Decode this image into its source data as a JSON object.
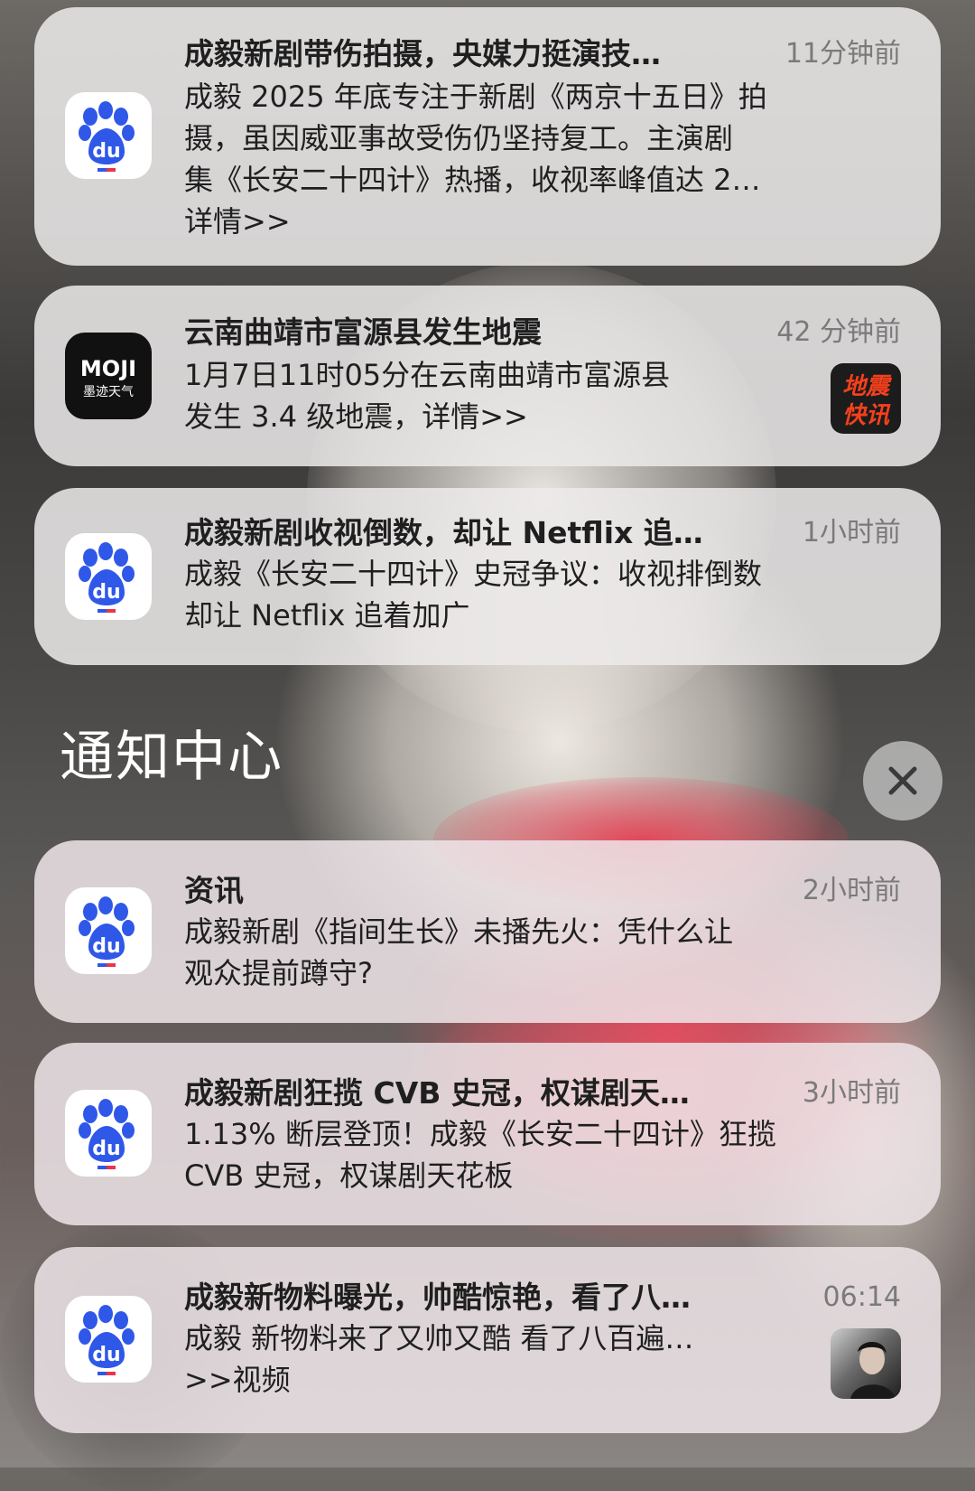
{
  "notifications_top": [
    {
      "app": "baidu",
      "title": "成毅新剧带伤拍摄，央媒力挺演技…",
      "time": "11分钟前",
      "body": [
        "成毅 2025 年底专注于新剧《两京十五日》拍",
        "摄，虽因威亚事故受伤仍坚持复工。主演剧",
        "集《长安二十四计》热播，收视率峰值达 2…",
        "详情>>"
      ]
    },
    {
      "app": "moji",
      "app_label_top": "MOJI",
      "app_label_bottom": "墨迹天气",
      "title": "云南曲靖市富源县发生地震",
      "time": "42 分钟前",
      "body": [
        "1月7日11时05分在云南曲靖市富源县",
        "发生 3.4 级地震，详情>>"
      ],
      "badge_line1": "地震",
      "badge_line2": "快讯"
    },
    {
      "app": "baidu",
      "title": "成毅新剧收视倒数，却让 Netflix 追…",
      "time": "1小时前",
      "body": [
        "成毅《长安二十四计》史冠争议：收视排倒数",
        "却让 Netflix 追着加广"
      ]
    }
  ],
  "notification_center": {
    "title": "通知中心",
    "close_icon": "close-icon"
  },
  "notifications_bottom": [
    {
      "app": "baidu",
      "title": "资讯",
      "time": "2小时前",
      "body": [
        "成毅新剧《指间生长》未播先火：凭什么让",
        "观众提前蹲守?"
      ]
    },
    {
      "app": "baidu",
      "title": "成毅新剧狂揽 CVB 史冠，权谋剧天…",
      "time": "3小时前",
      "body": [
        "1.13% 断层登顶！成毅《长安二十四计》狂揽",
        "CVB 史冠，权谋剧天花板"
      ]
    },
    {
      "app": "baidu",
      "title": "成毅新物料曝光，帅酷惊艳，看了八…",
      "time": "06:14",
      "body": [
        "成毅 新物料来了又帅又酷 看了八百遍…",
        ">>视频"
      ]
    }
  ],
  "baidu_icon_text": "du",
  "colors": {
    "baidu_blue": "#2f58e8",
    "baidu_red": "#e8354a",
    "badge_orange": "#f5401c"
  }
}
